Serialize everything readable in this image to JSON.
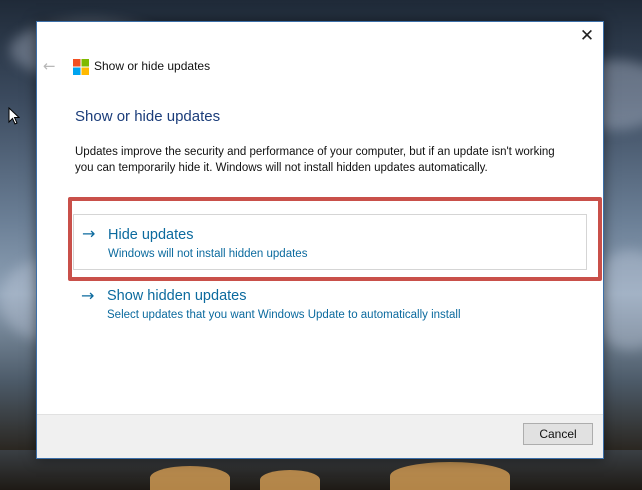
{
  "window": {
    "title": "Show or hide updates",
    "close_icon": "close-icon",
    "back_icon": "back-arrow-icon",
    "app_icon": "windows-logo-icon",
    "accent_color": "#0b6a9e",
    "highlight_color": "#c9504a"
  },
  "content": {
    "heading": "Show or hide updates",
    "description": "Updates improve the security and performance of your computer, but if an update isn't working you can temporarily hide it. Windows will not install hidden updates automatically."
  },
  "options": [
    {
      "arrow": "→",
      "title": "Hide updates",
      "description": "Windows will not install hidden updates",
      "highlighted": true
    },
    {
      "arrow": "→",
      "title": "Show hidden updates",
      "description": "Select updates that you want Windows Update to automatically install",
      "highlighted": false
    }
  ],
  "footer": {
    "cancel_label": "Cancel"
  }
}
